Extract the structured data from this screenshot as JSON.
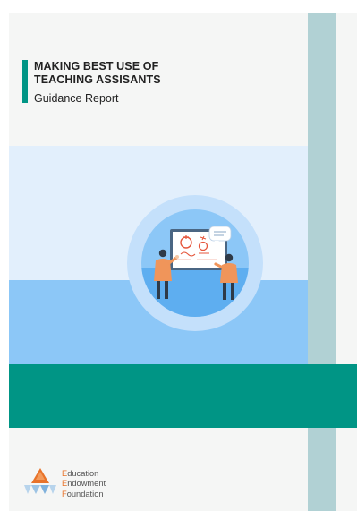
{
  "cover": {
    "title_line1": "MAKING BEST USE OF",
    "title_line2": "TEACHING ASSISANTS",
    "subtitle": "Guidance Report"
  },
  "logo": {
    "lines": [
      {
        "initial": "E",
        "rest": "ducation"
      },
      {
        "initial": "E",
        "rest": "ndowment"
      },
      {
        "initial": "F",
        "rest": "oundation"
      }
    ]
  },
  "colors": {
    "accent": "#009585",
    "side_strip": "#b1d1d4",
    "sky": "#e2effc",
    "ground": "#8cc7f7",
    "figure": "#f0955a",
    "logo_orange": "#e8732a",
    "logo_blue": "#9cc3e4"
  }
}
